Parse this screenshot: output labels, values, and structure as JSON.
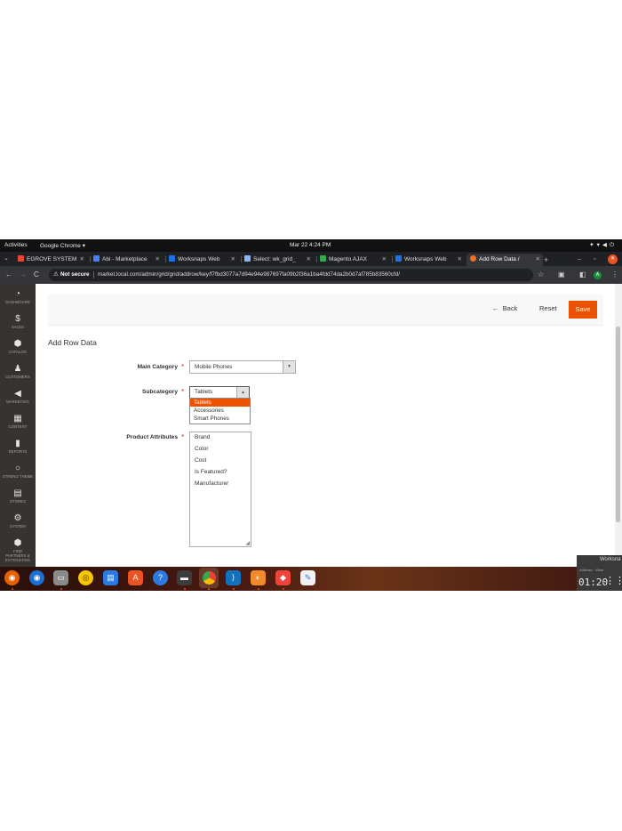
{
  "topbar": {
    "activities": "Activities",
    "app": "Google Chrome ▾",
    "clock": "Mar 22  4:24 PM",
    "tray_icons": [
      "accessibility-icon",
      "network-icon",
      "volume-icon",
      "power-icon"
    ]
  },
  "tabs": [
    {
      "title": "EGROVE SYSTEM",
      "icon_color": "#ea4335"
    },
    {
      "title": "Abi - Marketplace",
      "icon_color": "#4285f4"
    },
    {
      "title": "Worksnaps Web",
      "icon_color": "#1a73e8"
    },
    {
      "title": "Select: wk_grid_",
      "icon_color": "#8ab4f8"
    },
    {
      "title": "Magento AJAX",
      "icon_color": "#34a853"
    },
    {
      "title": "Worksnaps Web",
      "icon_color": "#1a73e8"
    },
    {
      "title": "Add Row Data /",
      "icon_color": "#f46f25",
      "active": true
    }
  ],
  "address_bar": {
    "security": "Not secure",
    "url": "market.local.com/admin/grid/grid/addrow/key/f7fbd3077a7d94e94e987697fa09b2f36a1ba4fdd74da2b0d7af785b83560cfd/",
    "profile_initial": "A"
  },
  "sidebar": {
    "items": [
      {
        "label": "DASHBOARD",
        "icon": "dashboard-icon",
        "glyph": "◔"
      },
      {
        "label": "SALES",
        "icon": "dollar-icon",
        "glyph": "$"
      },
      {
        "label": "CATALOG",
        "icon": "cube-icon",
        "glyph": "⬢"
      },
      {
        "label": "CUSTOMERS",
        "icon": "person-icon",
        "glyph": "♟"
      },
      {
        "label": "MARKETING",
        "icon": "megaphone-icon",
        "glyph": "◀"
      },
      {
        "label": "CONTENT",
        "icon": "layout-icon",
        "glyph": "▦"
      },
      {
        "label": "REPORTS",
        "icon": "bar-chart-icon",
        "glyph": "▮"
      },
      {
        "label": "STRENO THEME",
        "icon": "circle-icon",
        "glyph": "○"
      },
      {
        "label": "STORES",
        "icon": "store-icon",
        "glyph": "▤"
      },
      {
        "label": "SYSTEM",
        "icon": "gear-icon",
        "glyph": "⚙"
      },
      {
        "label": "FIND PARTNERS & EXTENSIONS",
        "icon": "box-icon",
        "glyph": "⬢"
      }
    ]
  },
  "actions": {
    "back": "Back",
    "reset": "Reset",
    "save": "Save"
  },
  "page_title": "Add Row Data",
  "form": {
    "main_category_label": "Main Category",
    "main_category_value": "Mobile Phones",
    "subcategory_label": "Subcategory",
    "subcategory_value": "Tablets",
    "subcategory_options": [
      "Tablets",
      "Accessories",
      "Smart Phones"
    ],
    "product_attributes_label": "Product Attributes",
    "product_attributes_options": [
      "Brand",
      "Color",
      "Cost",
      "Is Featured?",
      "Manufacturer"
    ],
    "required_mark": "*"
  },
  "dock": {
    "apps": [
      "firefox-icon",
      "thunderbird-icon",
      "files-icon",
      "rhythmbox-icon",
      "writer-icon",
      "software-icon",
      "help-icon",
      "terminal-icon",
      "chrome-icon",
      "vscode-icon",
      "photo-icon",
      "anydesk-icon",
      "text-editor-icon"
    ]
  },
  "notification": {
    "title": "Worksna",
    "subtitle": "Address · Wkst",
    "time": "01:20"
  },
  "colors": {
    "accent": "#eb5202",
    "sidebar": "#373330"
  }
}
